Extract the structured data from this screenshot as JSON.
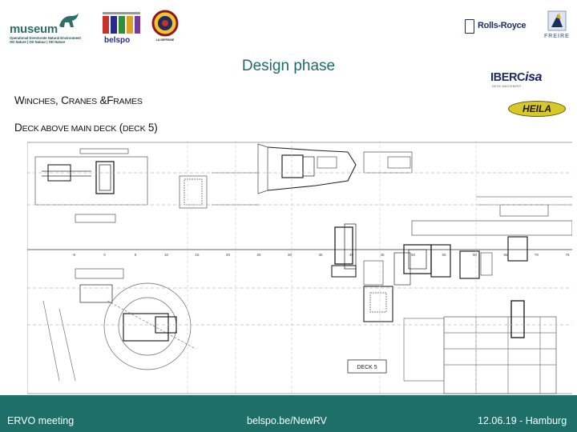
{
  "logos": {
    "museum": {
      "word": "museum",
      "sub_line_1": "Operational Directorate Natural Environment",
      "sub_line_2": "OD Nature | OD Natuur | OD Nature"
    },
    "belspo": {
      "word": "belspo"
    },
    "seal": {
      "text": "LA DEFENSE"
    },
    "rolls_royce": {
      "text": "Rolls-Royce"
    },
    "freire": {
      "text": "FREIRE"
    },
    "ibercisa": {
      "text_main": "IBERC",
      "text_accent": "isa",
      "sub": "DECK MACHINERY"
    },
    "heila": {
      "text": "HEILA"
    }
  },
  "slide": {
    "title": "Design phase",
    "heading_1": {
      "w": "W",
      "inches": "INCHES",
      "comma": ", ",
      "c": "C",
      "ranes": "RANES",
      "amp": " &",
      "f": "F",
      "rames": "RAMES"
    },
    "heading_2": {
      "d": "D",
      "rest": "ECK ABOVE MAIN DECK",
      "paren_open": " (",
      "deck": "DECK",
      "num": " 5)"
    }
  },
  "drawing": {
    "label_deck": "DECK 5",
    "frame_labels": [
      "-5",
      "0",
      "5",
      "10",
      "15",
      "20",
      "25",
      "30",
      "35",
      "40",
      "45",
      "50",
      "55",
      "60",
      "65",
      "70",
      "75"
    ]
  },
  "footer": {
    "left": "ERVO meeting",
    "center": "belspo.be/NewRV",
    "right": "12.06.19 -  Hamburg"
  },
  "colors": {
    "title": "#1f6a6a",
    "footer_bg": "#1d6f68",
    "museum": "#2f6f6b"
  }
}
